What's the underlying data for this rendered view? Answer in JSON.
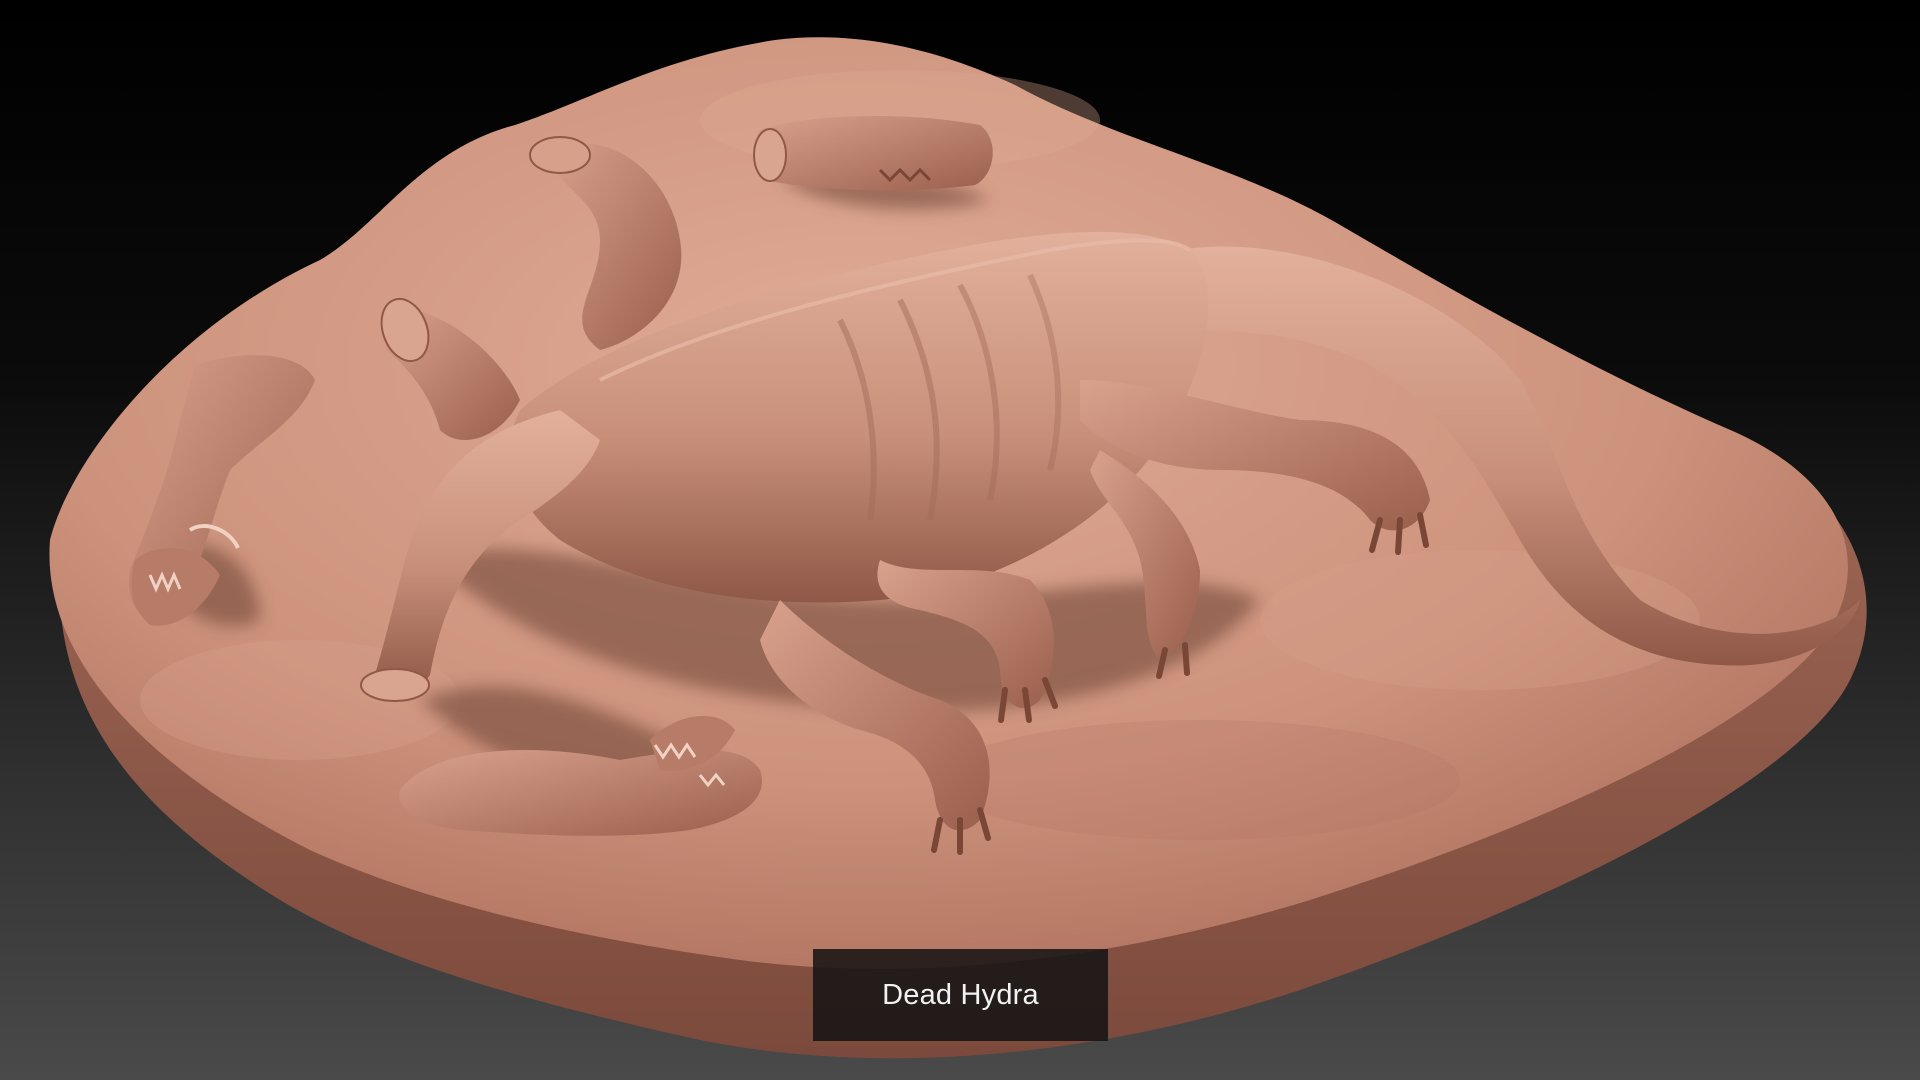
{
  "caption": {
    "text": "Dead Hydra"
  },
  "render": {
    "subject": "sculpted-hydra-carcass-on-rock-base",
    "material_color": "#c98f7a",
    "shadow_color": "#6b3f33",
    "highlight_color": "#e4b39f",
    "background_top": "#000000",
    "background_bottom": "#4a4a4a"
  }
}
